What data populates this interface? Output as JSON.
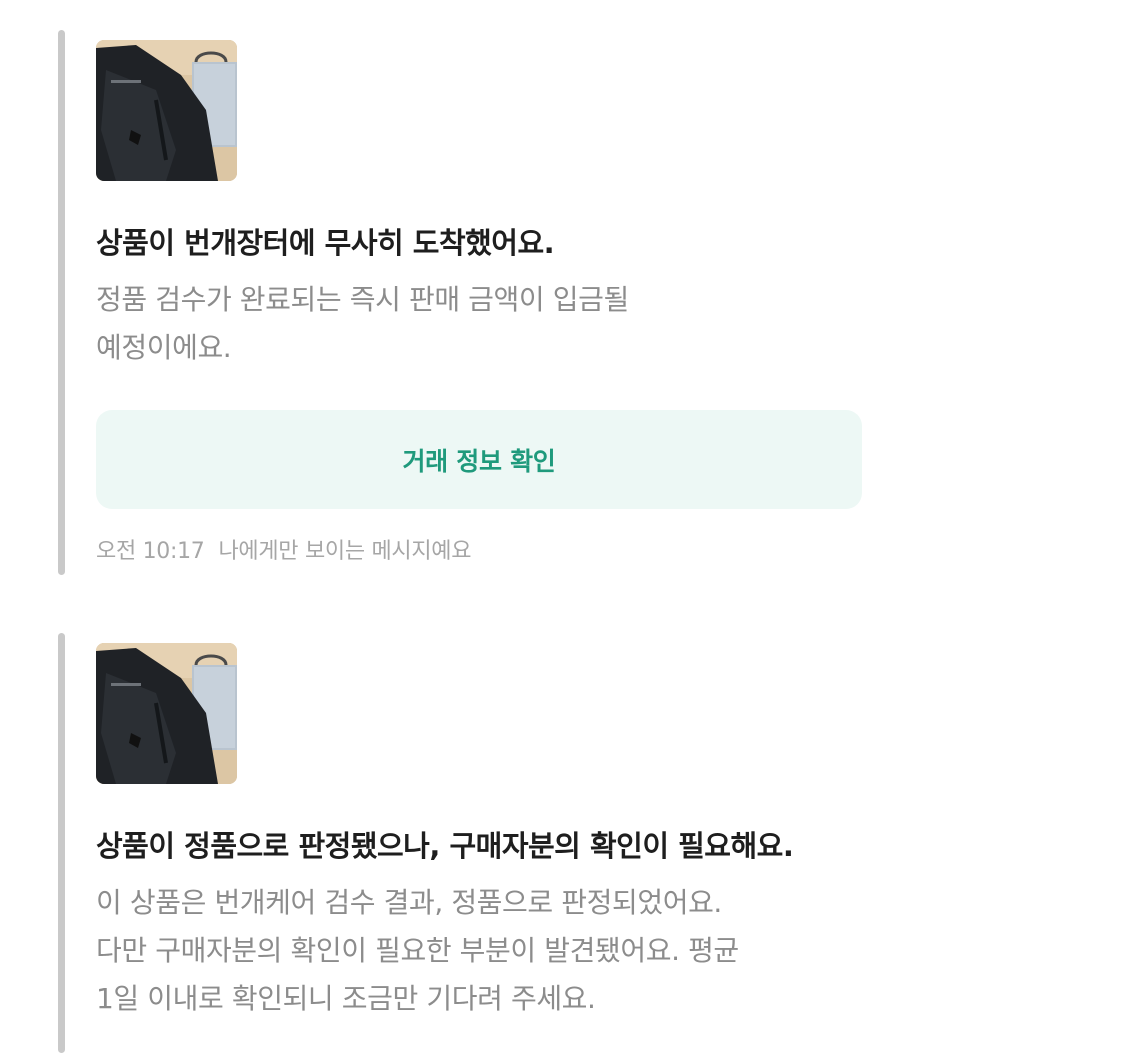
{
  "messages": [
    {
      "image_icon": "product-photo",
      "title": "상품이 번개장터에 무사히 도착했어요.",
      "body_lines": [
        "정품 검수가 완료되는 즉시 판매 금액이 입금될",
        "예정이에요."
      ],
      "action_label": "거래 정보 확인",
      "time": "오전 10:17",
      "visibility_note": "나에게만 보이는 메시지예요"
    },
    {
      "image_icon": "product-photo",
      "title": "상품이 정품으로 판정됐으나, 구매자분의 확인이 필요해요.",
      "body_lines": [
        "이 상품은 번개케어 검수 결과, 정품으로 판정되었어요.",
        "다만 구매자분의 확인이 필요한 부분이 발견됐어요. 평균",
        "1일 이내로 확인되니 조금만 기다려 주세요."
      ]
    }
  ],
  "colors": {
    "accent_text": "#1f9a7c",
    "accent_bg": "#edf8f5",
    "title": "#1e1e1e",
    "body": "#8c8c8c",
    "meta": "#a6a6a6",
    "bar": "#c9c9c9"
  }
}
